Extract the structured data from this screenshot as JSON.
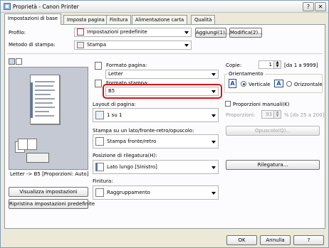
{
  "window": {
    "title": "Proprietà - Canon Printer",
    "help": "?",
    "close": "✕"
  },
  "tabs": [
    {
      "label": "Impostazioni di base",
      "active": true
    },
    {
      "label": "Imposta pagina"
    },
    {
      "label": "Finitura"
    },
    {
      "label": "Alimentazione carta"
    },
    {
      "label": "Qualità"
    }
  ],
  "profile": {
    "label": "Profilo:",
    "value": "Impostazioni predefinite",
    "add_button": "Aggiungi(1)...",
    "modify_button": "Modifica(2)..."
  },
  "output_method": {
    "label": "Metodo di stampa:",
    "value": "Stampa"
  },
  "preview": {
    "caption": "Letter -> B5 [Proporzioni: Auto]"
  },
  "page_size": {
    "label": "Formato pagina:",
    "value": "Letter"
  },
  "output_size": {
    "label": "Formato stampa:",
    "value": "B5"
  },
  "copies": {
    "label": "Copie:",
    "value": "1",
    "range": "[da 1 a 9999]"
  },
  "orientation": {
    "label": "Orientamento",
    "portrait": "Verticale",
    "landscape": "Orizzontale",
    "selected": "portrait"
  },
  "page_layout": {
    "label": "Layout di pagina:",
    "value": "1 su 1"
  },
  "manual_scaling": {
    "label": "Proporzioni manuali(K)",
    "checked": false,
    "scaling_label": "Proporzioni:",
    "scaling_value": "93",
    "range": "% [da 25 a 200]"
  },
  "print_style": {
    "label": "Stampa su un lato/fronte-retro/opuscolo:",
    "value": "Stampa fronte/retro",
    "booklet_button": "Opuscolo(Q)..."
  },
  "binding": {
    "label": "Posizione di rilegatura(H):",
    "value": "Lato lungo [Sinistro]",
    "gutter_button": "Rilegatura..."
  },
  "finishing": {
    "label": "Finitura:",
    "value": "Raggruppamento"
  },
  "left_buttons": {
    "view_settings": "Visualizza impostazioni",
    "restore_defaults": "Ripristina impostazioni predefinite"
  },
  "footer": {
    "ok": "OK",
    "cancel": "Annulla",
    "help": "?"
  }
}
